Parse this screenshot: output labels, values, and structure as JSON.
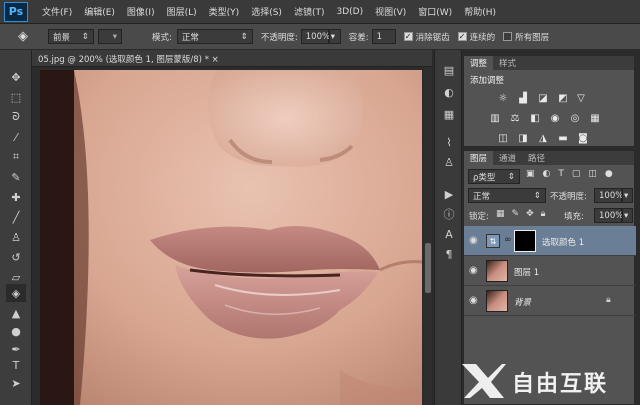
{
  "app": {
    "logo": "Ps"
  },
  "menu": [
    "文件(F)",
    "编辑(E)",
    "图像(I)",
    "图层(L)",
    "类型(Y)",
    "选择(S)",
    "滤镜(T)",
    "3D(D)",
    "视图(V)",
    "窗口(W)",
    "帮助(H)"
  ],
  "options": {
    "fg_select": "前景",
    "mode_label": "模式:",
    "mode_value": "正常",
    "opacity_label": "不透明度:",
    "opacity_value": "100%",
    "tolerance_label": "容差:",
    "tolerance_value": "1",
    "antialias_label": "消除锯齿",
    "contiguous_label": "连续的",
    "all_layers_label": "所有图层"
  },
  "document": {
    "tab_title": "05.jpg @ 200% (选取颜色 1, 图层蒙版/8) *",
    "close": "×"
  },
  "panels": {
    "adjust_tabs": [
      "调整",
      "样式"
    ],
    "adjust_title": "添加调整",
    "layers_tabs": [
      "图层",
      "通道",
      "路径"
    ],
    "kind_filter": "ρ类型",
    "blend_mode": "正常",
    "opacity_label": "不透明度:",
    "opacity_value": "100%",
    "lock_label": "锁定:",
    "fill_label": "填充:",
    "fill_value": "100%"
  },
  "layers": [
    {
      "name": "选取颜色 1",
      "selected": true,
      "type": "adjustment"
    },
    {
      "name": "图层 1",
      "selected": false,
      "type": "pixel"
    },
    {
      "name": "背景",
      "selected": false,
      "type": "background",
      "locked": true
    }
  ],
  "watermark": {
    "text": "自由互联"
  },
  "colors": {
    "accent_ps": "#2f8fd8",
    "selected_layer": "#6a7f96",
    "panel_bg": "#535353"
  }
}
